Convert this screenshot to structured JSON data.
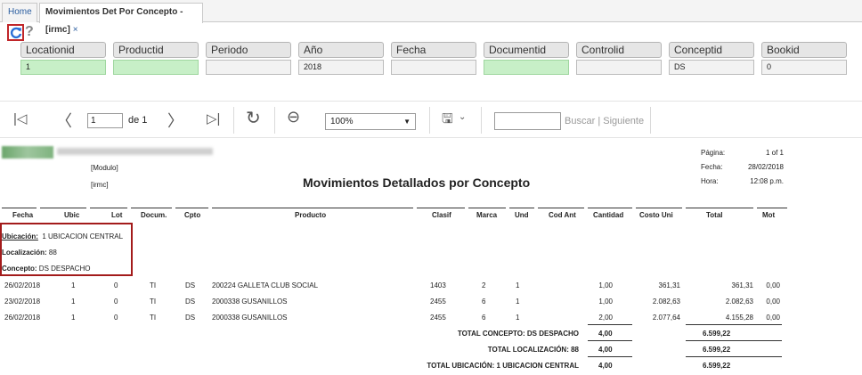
{
  "tabs": {
    "home": "Home",
    "active": "Movimientos Det Por Concepto -[irmc]",
    "close": "×"
  },
  "params": [
    {
      "label": "Locationid",
      "value": "1"
    },
    {
      "label": "Productid",
      "value": ""
    },
    {
      "label": "Periodo",
      "value": ""
    },
    {
      "label": "Año",
      "value": "2018"
    },
    {
      "label": "Fecha",
      "value": ""
    },
    {
      "label": "Documentid",
      "value": ""
    },
    {
      "label": "Controlid",
      "value": ""
    },
    {
      "label": "Conceptid",
      "value": "DS"
    },
    {
      "label": "Bookid",
      "value": "0"
    }
  ],
  "toolbar": {
    "page": "1",
    "of": "de 1",
    "zoom": "100%",
    "find": "Buscar",
    "sep": "|",
    "next": "Siguiente"
  },
  "report": {
    "modulo": "[Modulo]",
    "code": "[irmc]",
    "title": "Movimientos Detallados por Concepto",
    "meta": {
      "page_label": "Página:",
      "page_value": "1 of 1",
      "date_label": "Fecha:",
      "date_value": "28/02/2018",
      "time_label": "Hora:",
      "time_value": "12:08 p.m."
    },
    "columns": [
      "Fecha",
      "Ubic",
      "Lot",
      "Docum.",
      "Cpto",
      "Producto",
      "Clasif",
      "Marca",
      "Und",
      "Cod Ant",
      "Cantidad",
      "Costo Uni",
      "Total",
      "Mot"
    ],
    "group": {
      "ubic_label": "Ubicación:",
      "ubic_value": "1 UBICACION CENTRAL",
      "loc_label": "Localización:",
      "loc_value": "88",
      "concept_label": "Concepto:",
      "concept_value": "DS  DESPACHO"
    },
    "rows": [
      {
        "fecha": "26/02/2018",
        "ubic": "1",
        "lot": "0",
        "docum": "TI",
        "cpto": "DS",
        "producto": "200224  GALLETA CLUB SOCIAL",
        "clasif": "1403",
        "marca": "2",
        "und": "1",
        "cantidad": "1,00",
        "costo": "361,31",
        "total": "361,31",
        "mot": "0,00"
      },
      {
        "fecha": "23/02/2018",
        "ubic": "1",
        "lot": "0",
        "docum": "TI",
        "cpto": "DS",
        "producto": "2000338  GUSANILLOS",
        "clasif": "2455",
        "marca": "6",
        "und": "1",
        "cantidad": "1,00",
        "costo": "2.082,63",
        "total": "2.082,63",
        "mot": "0,00"
      },
      {
        "fecha": "26/02/2018",
        "ubic": "1",
        "lot": "0",
        "docum": "TI",
        "cpto": "DS",
        "producto": "2000338  GUSANILLOS",
        "clasif": "2455",
        "marca": "6",
        "und": "1",
        "cantidad": "2,00",
        "costo": "2.077,64",
        "total": "4.155,28",
        "mot": "0,00"
      }
    ],
    "totals": [
      {
        "label": "TOTAL CONCEPTO: DS  DESPACHO",
        "cantidad": "4,00",
        "total": "6.599,22"
      },
      {
        "label": "TOTAL LOCALIZACIÓN: 88",
        "cantidad": "4,00",
        "total": "6.599,22"
      },
      {
        "label": "TOTAL UBICACIÓN: 1 UBICACION CENTRAL",
        "cantidad": "4,00",
        "total": "6.599,22"
      }
    ]
  },
  "colors": {
    "accent": "#2a5d9f",
    "highlight": "#a31b1b",
    "green_field": "#c7efc7"
  }
}
